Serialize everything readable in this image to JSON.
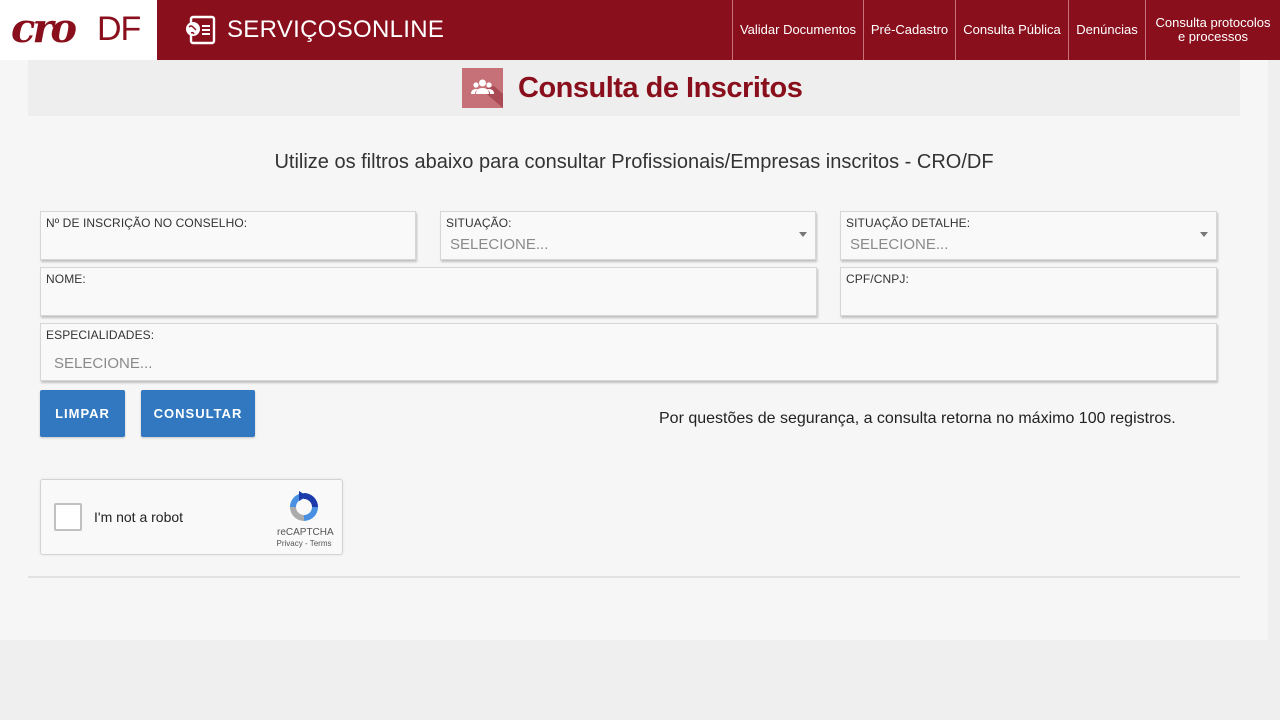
{
  "header": {
    "logo_cro": "cro",
    "logo_df": "DF",
    "brand": "SERVIÇOSONLINE",
    "brand_icon": "id-card-globe-icon",
    "nav": [
      {
        "label": "Validar Documentos"
      },
      {
        "label": "Pré-Cadastro"
      },
      {
        "label": "Consulta Pública"
      },
      {
        "label": "Denúncias"
      },
      {
        "label_line1": "Consulta protocolos",
        "label_line2": "e processos"
      }
    ]
  },
  "page": {
    "title": "Consulta de Inscritos",
    "title_icon": "users-icon",
    "subtitle": "Utilize os filtros abaixo para consultar Profissionais/Empresas inscritos - CRO/DF"
  },
  "form": {
    "inscricao": {
      "label": "Nº DE INSCRIÇÃO NO CONSELHO:",
      "value": ""
    },
    "situacao": {
      "label": "SITUAÇÃO:",
      "placeholder": "SELECIONE..."
    },
    "situacao_detalhe": {
      "label": "SITUAÇÃO DETALHE:",
      "placeholder": "SELECIONE..."
    },
    "nome": {
      "label": "NOME:",
      "value": ""
    },
    "cpf_cnpj": {
      "label": "CPF/CNPJ:",
      "value": ""
    },
    "especialidades": {
      "label": "ESPECIALIDADES:",
      "placeholder": "SELECIONE..."
    }
  },
  "actions": {
    "clear_label": "LIMPAR",
    "submit_label": "CONSULTAR",
    "note": "Por questões de segurança, a consulta retorna no máximo 100 registros."
  },
  "captcha": {
    "label": "I'm not a robot",
    "brand": "reCAPTCHA",
    "links": "Privacy - Terms"
  },
  "colors": {
    "brand": "#8a0f1c",
    "button": "#3178c0",
    "icon_bg": "#c67178"
  }
}
